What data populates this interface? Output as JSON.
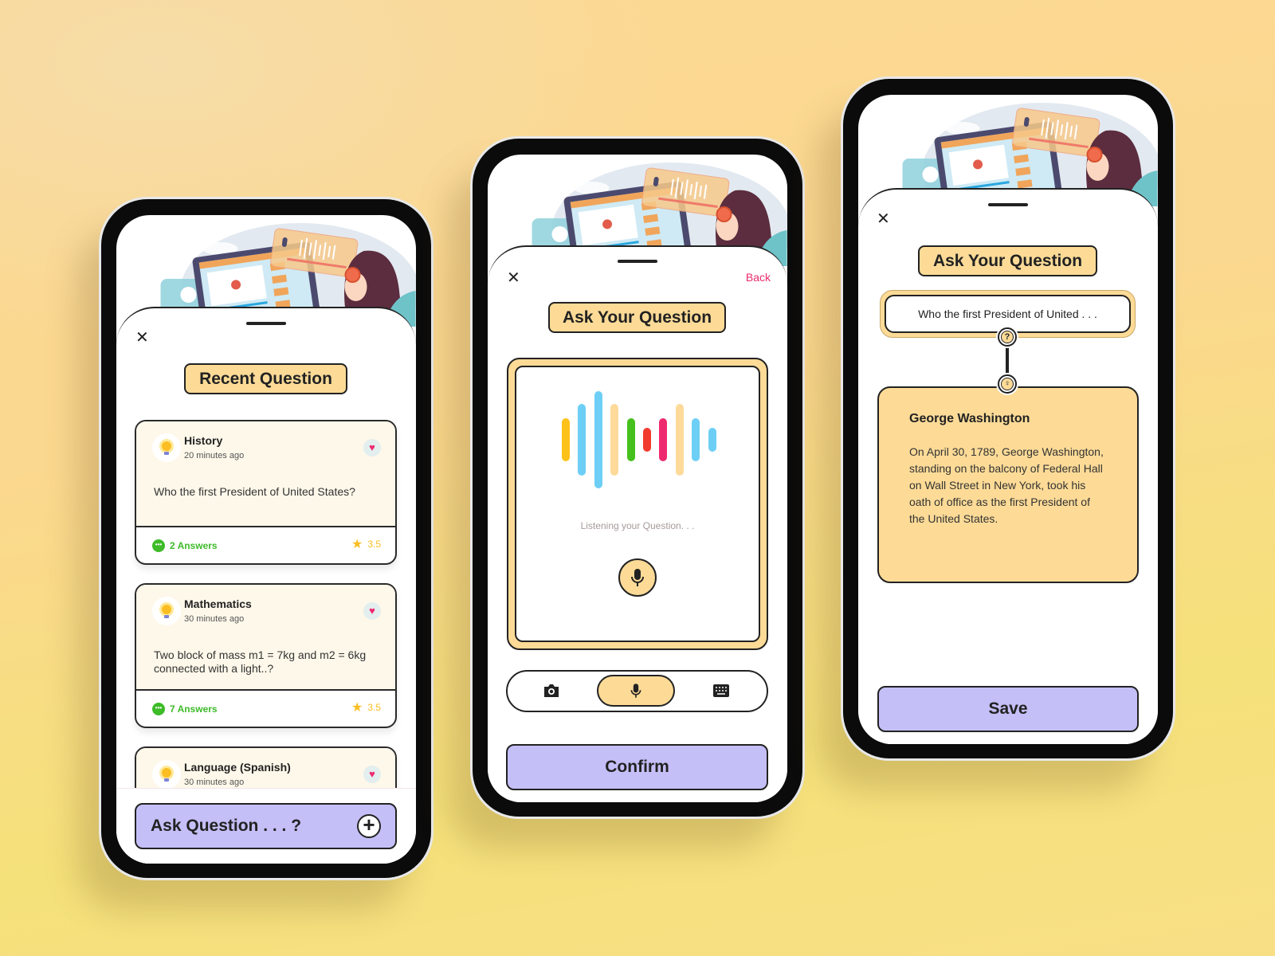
{
  "colors": {
    "accent": "#fddb97",
    "button": "#c4bff7",
    "answers": "#3dbb28",
    "rating": "#fbbe22",
    "heart": "#ee2a6e",
    "back": "#ee2a6e",
    "wave": [
      "#ffc21a",
      "#6ecff6",
      "#6ecff6",
      "#fdda9a",
      "#46c01c",
      "#f23b2f",
      "#ee2a6e",
      "#fdda9a",
      "#6ecff6",
      "#6ecff6"
    ]
  },
  "recent": {
    "close_icon": "close-icon",
    "title": "Recent Question",
    "cards": [
      {
        "category": "History",
        "time": "20 minutes ago",
        "question": "Who the first President of United States?",
        "answers": "2 Answers",
        "rating": "3.5"
      },
      {
        "category": "Mathematics",
        "time": "30 minutes ago",
        "question": "Two block of mass m1 = 7kg and m2 = 6kg connected with a light..?",
        "answers": "7 Answers",
        "rating": "3.5"
      },
      {
        "category": "Language (Spanish)",
        "time": "30 minutes ago"
      }
    ],
    "ask_button": "Ask Question . . . ?"
  },
  "voice": {
    "back": "Back",
    "title": "Ask Your Question",
    "status": "Listening your Question. . .",
    "modes": [
      "camera",
      "microphone",
      "keyboard"
    ],
    "active_mode": "microphone",
    "confirm": "Confirm"
  },
  "answer": {
    "title": "Ask Your Question",
    "question": "Who the first President of United . . .",
    "answer_title": "George Washington",
    "answer_text": "On April 30, 1789, George Washington, standing on the balcony of Federal Hall on Wall Street in New York, took his oath of office as the first President of the United States.",
    "save": "Save"
  }
}
